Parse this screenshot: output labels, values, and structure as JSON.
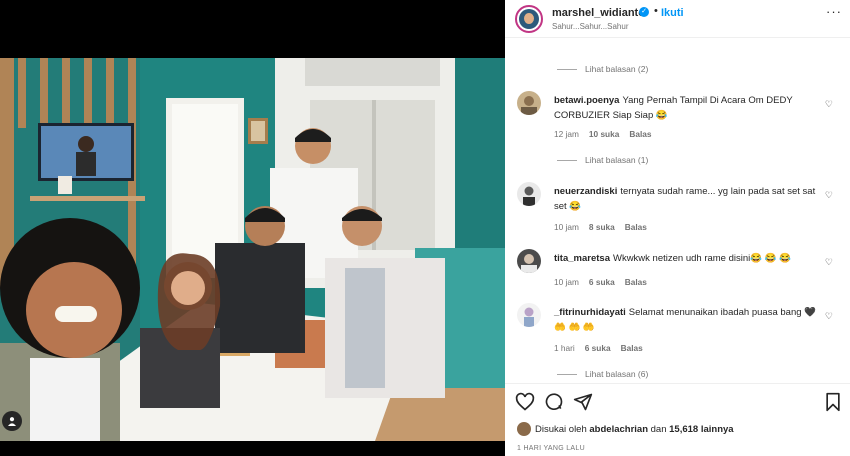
{
  "header": {
    "username": "marshel_widianto",
    "separator": "•",
    "follow_label": "Ikuti",
    "subtitle": "Sahur...Sahur...Sahur",
    "more_label": "···"
  },
  "replies_top": {
    "label": "Lihat balasan (2)"
  },
  "comments": [
    {
      "username": "betawi.poenya",
      "text": "Yang Pernah Tampil Di Acara Om DEDY CORBUZIER Siap Siap 😂",
      "time": "12 jam",
      "likes": "10 suka",
      "reply": "Balas",
      "view_replies": "Lihat balasan (1)"
    },
    {
      "username": "neuerzandiski",
      "text": "ternyata sudah rame... yg lain pada sat set sat set 😂",
      "time": "10 jam",
      "likes": "8 suka",
      "reply": "Balas",
      "view_replies": ""
    },
    {
      "username": "tita_maretsa",
      "text": "Wkwkwk netizen udh rame disini😂 😂 😂",
      "time": "10 jam",
      "likes": "6 suka",
      "reply": "Balas",
      "view_replies": ""
    },
    {
      "username": "_fitrinurhidayati",
      "text": "Selamat menunaikan ibadah puasa bang 🖤 🤲 🤲 🤲",
      "time": "1 hari",
      "likes": "6 suka",
      "reply": "Balas",
      "view_replies": "Lihat balasan (6)"
    }
  ],
  "actions": {
    "like_icon": "heart-icon",
    "comment_icon": "comment-icon",
    "share_icon": "share-icon",
    "save_icon": "bookmark-icon"
  },
  "likes_summary": {
    "prefix": "Disukai oleh",
    "user": "abdelachrian",
    "middle": "dan",
    "count": "15,618 lainnya"
  },
  "posted": "1 HARI YANG LALU",
  "colors": {
    "accent": "#0095f6",
    "muted": "#737373",
    "text": "#262626"
  }
}
